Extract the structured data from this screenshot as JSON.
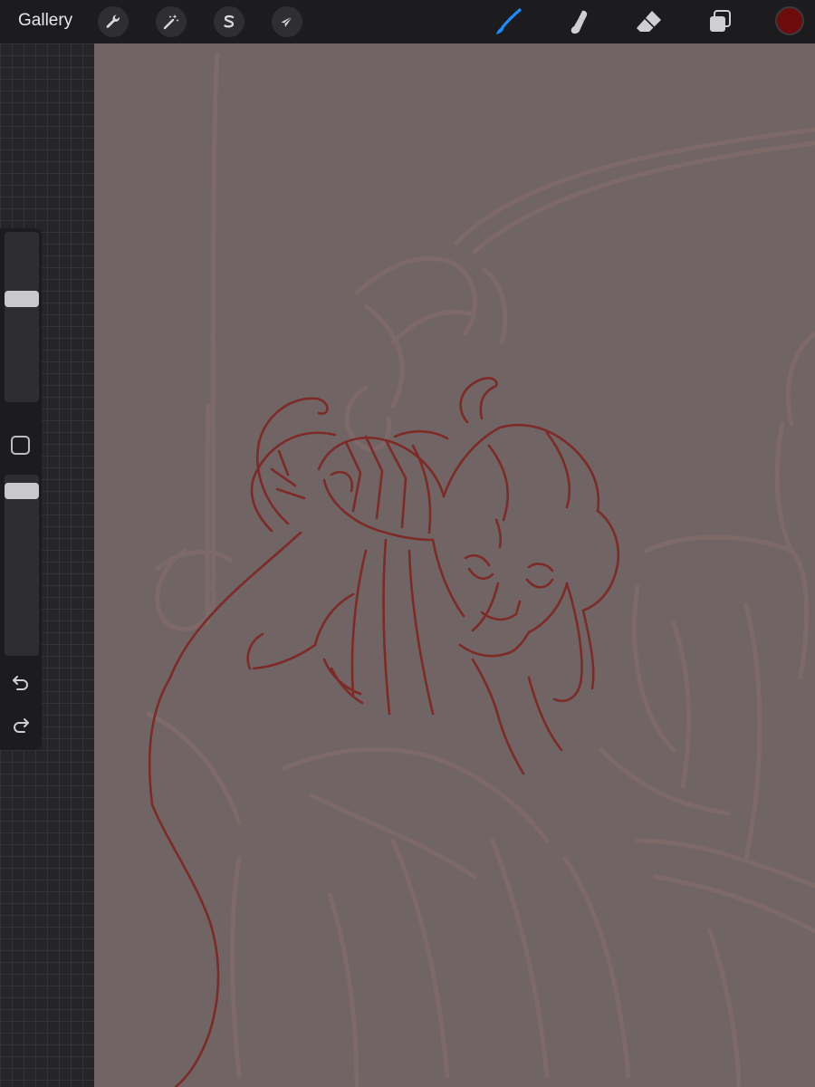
{
  "topbar": {
    "gallery_label": "Gallery",
    "left_tools": [
      {
        "name": "actions",
        "icon": "wrench-icon"
      },
      {
        "name": "adjustments",
        "icon": "magic-wand-icon"
      },
      {
        "name": "selection",
        "icon": "selection-s-icon"
      },
      {
        "name": "transform",
        "icon": "arrow-cursor-icon"
      }
    ],
    "right_tools": [
      {
        "name": "brush",
        "icon": "brush-icon",
        "active": true
      },
      {
        "name": "smudge",
        "icon": "smudge-finger-icon",
        "active": false
      },
      {
        "name": "eraser",
        "icon": "eraser-icon",
        "active": false
      },
      {
        "name": "layers",
        "icon": "layers-icon",
        "active": false
      }
    ],
    "current_color": "#6e0c0c",
    "active_tool_color": "#1a8cff"
  },
  "sidebar": {
    "brush_size_level": 0.62,
    "opacity_level": 0.95,
    "modify_button_icon": "square-modify-icon",
    "undo_icon": "undo-icon",
    "redo_icon": "redo-icon"
  },
  "canvas": {
    "background_color": "#706464",
    "sketch_color": "#7e2a27",
    "underlay_color": "#806a6a"
  }
}
